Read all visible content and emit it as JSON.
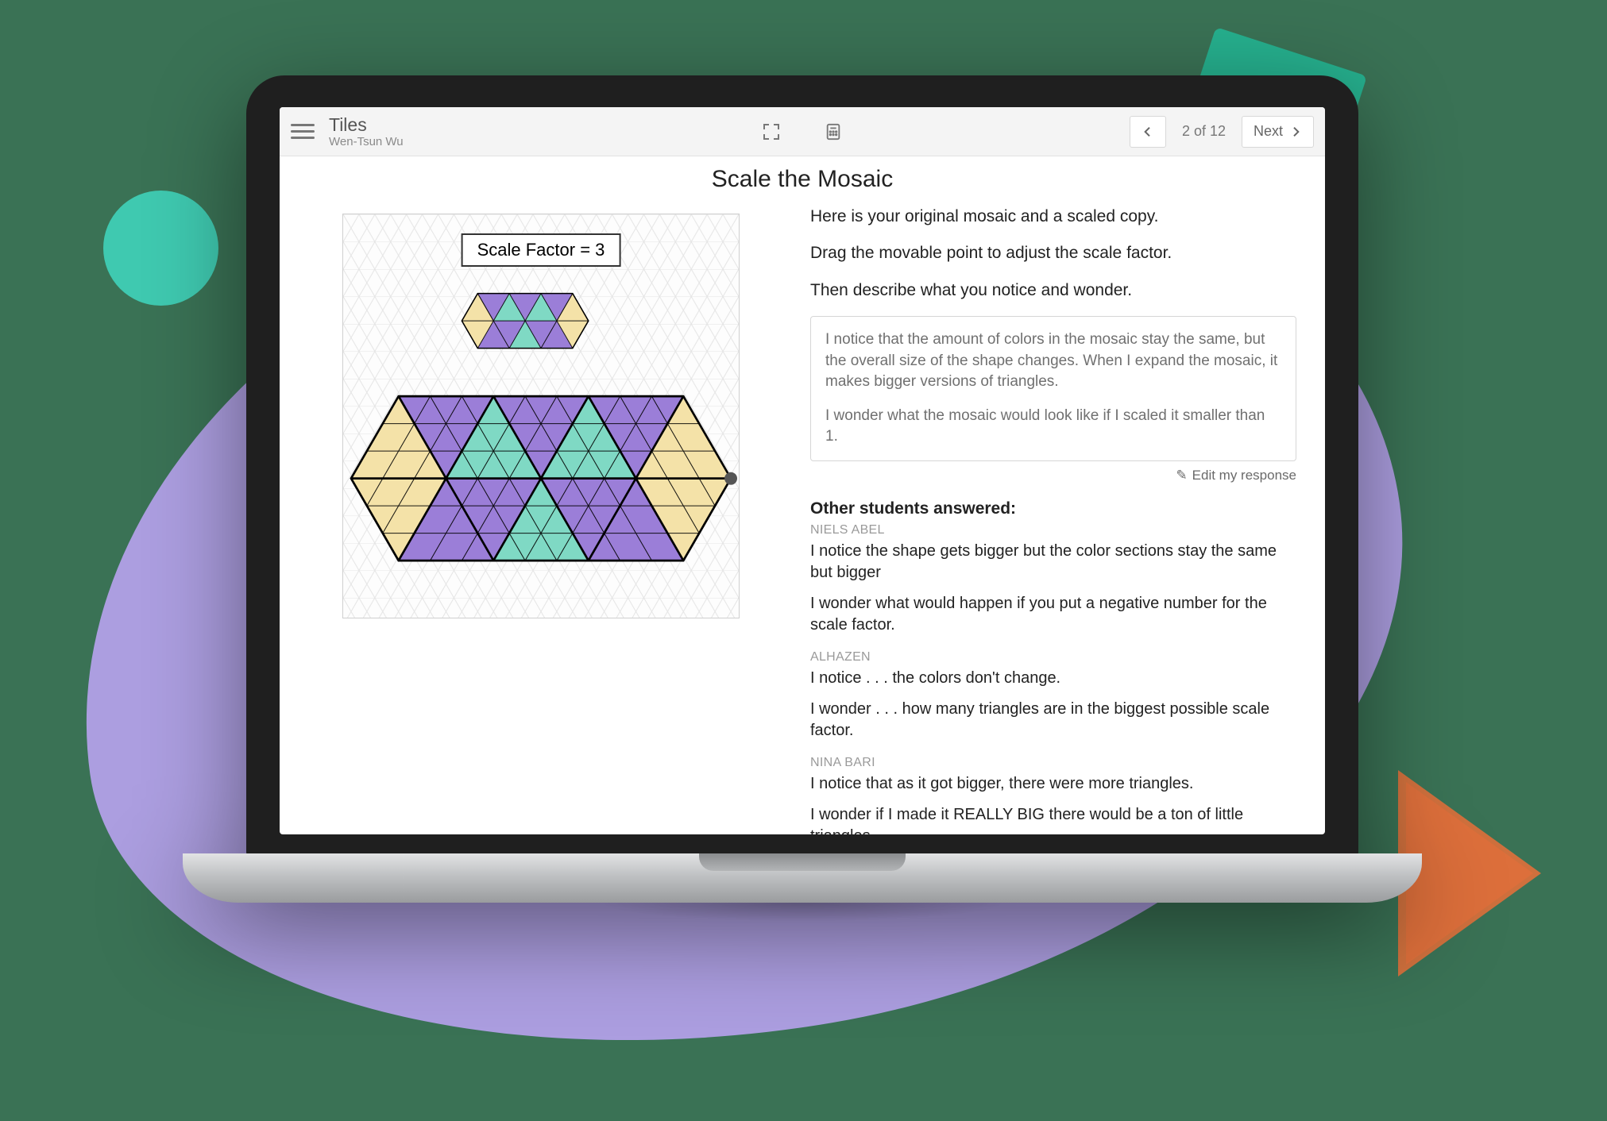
{
  "header": {
    "title": "Tiles",
    "subtitle": "Wen-Tsun Wu",
    "page_indicator": "2 of 12",
    "next_label": "Next"
  },
  "page": {
    "title": "Scale the Mosaic",
    "intro1": "Here is your original mosaic and a scaled copy.",
    "intro2": "Drag the movable point to adjust the scale factor.",
    "intro3": "Then describe what you notice and wonder.",
    "scale_factor_label": "Scale Factor = 3"
  },
  "response": {
    "line1": "I notice that the amount of colors in the mosaic stay the same, but the overall size of the shape changes. When I expand the mosaic, it makes bigger versions of triangles.",
    "line2": "I wonder what the mosaic would look like if I scaled it smaller than 1.",
    "edit_label": "Edit my response"
  },
  "others_heading": "Other students answered:",
  "students": [
    {
      "name": "NIELS ABEL",
      "notice": "I notice the shape gets bigger but the color sections stay the same but bigger",
      "wonder": "I wonder what would happen if you put a negative number for the scale factor."
    },
    {
      "name": "ALHAZEN",
      "notice": "I notice . . . the colors don't change.",
      "wonder": "I wonder . . . how many triangles are in the biggest possible scale factor."
    },
    {
      "name": "NINA BARI",
      "notice": "I notice that as it got bigger, there were more triangles.",
      "wonder": "I wonder if I made it REALLY BIG there would be a ton of little triangles."
    }
  ],
  "colors": {
    "purple": "#9b7ed8",
    "teal": "#7fd9c4",
    "cream": "#f4e2a8"
  }
}
